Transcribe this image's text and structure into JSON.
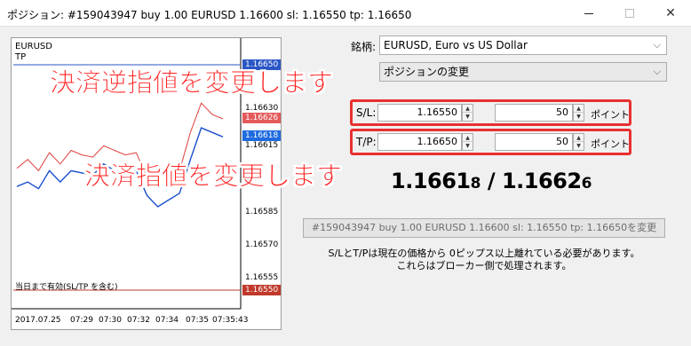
{
  "window": {
    "title": "ポジション: #159043947 buy 1.00 EURUSD 1.16600 sl: 1.16550 tp: 1.16650"
  },
  "chart": {
    "symbol": "EURUSD",
    "tp_label": "TP",
    "note": "当日まで有効(SL/TP を含む)",
    "price_labels": {
      "tp_price": "1.16650",
      "p1": "1.16630",
      "ask": "1.16626",
      "bid": "1.16618",
      "p2": "1.16615",
      "p3": "1.16585",
      "p4": "1.16570",
      "p5": "1.16555",
      "sl_price": "1.16550"
    },
    "time_labels": [
      "2017.07.25",
      "07:29",
      "07:30",
      "07:32",
      "07:34",
      "07:35",
      "07:35:43"
    ]
  },
  "chart_data": {
    "type": "line",
    "ylim": [
      1.1655,
      1.1665
    ],
    "series": [
      {
        "color": "#e04040",
        "values": [
          1.16604,
          1.16608,
          1.16603,
          1.16611,
          1.16606,
          1.16612,
          1.1661,
          1.16609,
          1.16614,
          1.16612,
          1.1661,
          1.16611,
          1.166,
          1.16602,
          1.16603,
          1.16603,
          1.1662,
          1.16633,
          1.16628,
          1.16626
        ]
      },
      {
        "color": "#1a4fcf",
        "values": [
          1.16596,
          1.16598,
          1.16595,
          1.16603,
          1.16598,
          1.16603,
          1.16602,
          1.16601,
          1.16606,
          1.16603,
          1.16602,
          1.16603,
          1.16592,
          1.16587,
          1.1659,
          1.16593,
          1.16608,
          1.16622,
          1.1662,
          1.16618
        ]
      }
    ],
    "hlines": [
      {
        "value": 1.1665,
        "color": "#2a56c6"
      },
      {
        "value": 1.1655,
        "color": "#c0392b"
      }
    ]
  },
  "form": {
    "symbol_label": "銘柄:",
    "symbol_value": "EURUSD, Euro vs US Dollar",
    "type_value": "ポジションの変更",
    "sl": {
      "label": "S/L:",
      "value": "1.16550",
      "points": "50",
      "points_label": "ポイント"
    },
    "tp": {
      "label": "T/P:",
      "value": "1.16650",
      "points": "50",
      "points_label": "ポイント"
    },
    "price_bid_main": "1.1661",
    "price_bid_small": "8",
    "price_sep": " / ",
    "price_ask_main": "1.1662",
    "price_ask_small": "6",
    "modify_button": "#159043947 buy 1.00 EURUSD 1.16600 sl: 1.16550 tp: 1.16650を変更",
    "info_line1": "S/LとT/Pは現在の価格から 0ピップス以上離れている必要があります。",
    "info_line2": "これらはブローカー側で処理されます。"
  },
  "annotations": {
    "stop_loss_text": "決済逆指値を変更します",
    "take_profit_text": "決済指値を変更します"
  },
  "colors": {
    "annotation": "#ff2020",
    "highlight_box": "#e83030"
  }
}
